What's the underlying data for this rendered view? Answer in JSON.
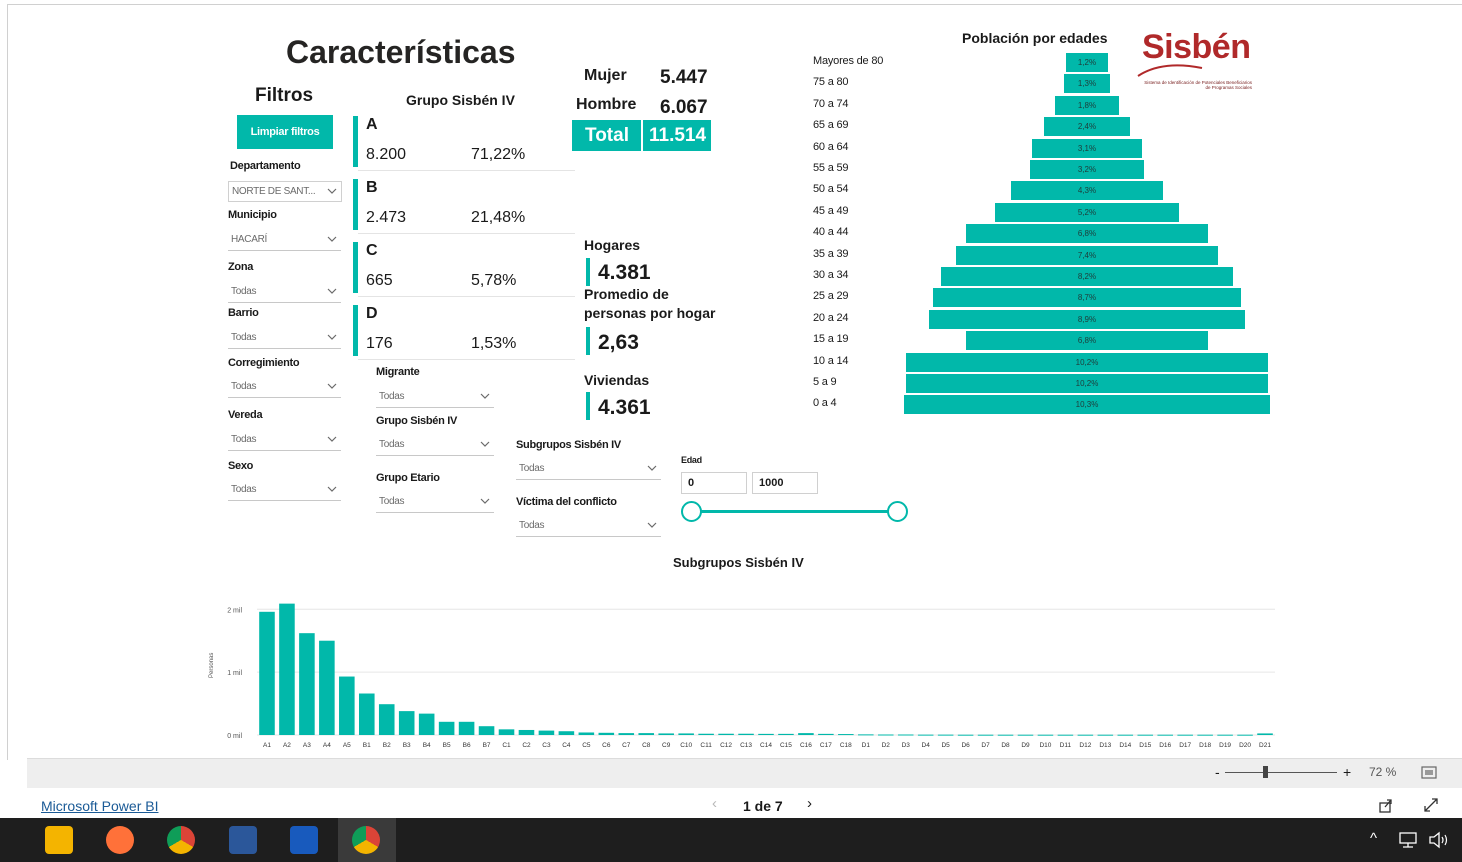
{
  "title": "Características",
  "filters": {
    "heading": "Filtros",
    "clear_button": "Limpiar filtros",
    "departamento": {
      "label": "Departamento",
      "value": "NORTE DE SANT..."
    },
    "municipio": {
      "label": "Municipio",
      "value": "HACARÍ"
    },
    "zona": {
      "label": "Zona",
      "value": "Todas"
    },
    "barrio": {
      "label": "Barrio",
      "value": "Todas"
    },
    "corregimiento": {
      "label": "Corregimiento",
      "value": "Todas"
    },
    "vereda": {
      "label": "Vereda",
      "value": "Todas"
    },
    "sexo": {
      "label": "Sexo",
      "value": "Todas"
    },
    "migrante": {
      "label": "Migrante",
      "value": "Todas"
    },
    "grupo_sisben": {
      "label": "Grupo Sisbén IV",
      "value": "Todas"
    },
    "grupo_etario": {
      "label": "Grupo Etario",
      "value": "Todas"
    },
    "subgrupos": {
      "label": "Subgrupos Sisbén IV",
      "value": "Todas"
    },
    "victima": {
      "label": "Víctima del conflicto",
      "value": "Todas"
    },
    "edad": {
      "label": "Edad",
      "min": "0",
      "max": "1000"
    }
  },
  "groups": {
    "heading": "Grupo Sisbén IV",
    "items": [
      {
        "letter": "A",
        "count": "8.200",
        "pct": "71,22%"
      },
      {
        "letter": "B",
        "count": "2.473",
        "pct": "21,48%"
      },
      {
        "letter": "C",
        "count": "665",
        "pct": "5,78%"
      },
      {
        "letter": "D",
        "count": "176",
        "pct": "1,53%"
      }
    ]
  },
  "sex": {
    "mujer_label": "Mujer",
    "mujer_value": "5.447",
    "hombre_label": "Hombre",
    "hombre_value": "6.067",
    "total_label": "Total",
    "total_value": "11.514"
  },
  "kpis": {
    "hogares_label": "Hogares",
    "hogares_value": "4.381",
    "promedio_label_1": "Promedio de",
    "promedio_label_2": "personas por hogar",
    "promedio_value": "2,63",
    "viviendas_label": "Viviendas",
    "viviendas_value": "4.361"
  },
  "pyramid": {
    "title": "Población por edades",
    "rows": [
      {
        "label": "Mayores de 80",
        "pct": "1,2%",
        "value": 1.2
      },
      {
        "label": "75 a 80",
        "pct": "1,3%",
        "value": 1.3
      },
      {
        "label": "70 a 74",
        "pct": "1,8%",
        "value": 1.8
      },
      {
        "label": "65 a 69",
        "pct": "2,4%",
        "value": 2.4
      },
      {
        "label": "60 a 64",
        "pct": "3,1%",
        "value": 3.1
      },
      {
        "label": "55 a 59",
        "pct": "3,2%",
        "value": 3.2
      },
      {
        "label": "50 a 54",
        "pct": "4,3%",
        "value": 4.3
      },
      {
        "label": "45 a 49",
        "pct": "5,2%",
        "value": 5.2
      },
      {
        "label": "40 a 44",
        "pct": "6,8%",
        "value": 6.8
      },
      {
        "label": "35 a 39",
        "pct": "7,4%",
        "value": 7.4
      },
      {
        "label": "30 a 34",
        "pct": "8,2%",
        "value": 8.2
      },
      {
        "label": "25 a 29",
        "pct": "8,7%",
        "value": 8.7
      },
      {
        "label": "20 a 24",
        "pct": "8,9%",
        "value": 8.9
      },
      {
        "label": "15 a 19",
        "pct": "6,8%",
        "value": 6.8
      },
      {
        "label": "10 a 14",
        "pct": "10,2%",
        "value": 10.2
      },
      {
        "label": "5 a 9",
        "pct": "10,2%",
        "value": 10.2
      },
      {
        "label": "0 a 4",
        "pct": "10,3%",
        "value": 10.3
      }
    ]
  },
  "logo": {
    "word": "Sisbén",
    "tagline": "Sistema de Identificación de Potenciales Beneficiarios de Programas Sociales"
  },
  "chart_data": {
    "type": "bar",
    "title": "Subgrupos Sisbén IV",
    "ylabel": "Personas",
    "yticks": [
      "0 mil",
      "1 mil",
      "2 mil"
    ],
    "ylim": [
      0,
      2100
    ],
    "categories": [
      "A1",
      "A2",
      "A3",
      "A4",
      "A5",
      "B1",
      "B2",
      "B3",
      "B4",
      "B5",
      "B6",
      "B7",
      "C1",
      "C2",
      "C3",
      "C4",
      "C5",
      "C6",
      "C7",
      "C8",
      "C9",
      "C10",
      "C11",
      "C12",
      "C13",
      "C14",
      "C15",
      "C16",
      "C17",
      "C18",
      "D1",
      "D2",
      "D3",
      "D4",
      "D5",
      "D6",
      "D7",
      "D8",
      "D9",
      "D10",
      "D11",
      "D12",
      "D13",
      "D14",
      "D15",
      "D16",
      "D17",
      "D18",
      "D19",
      "D20",
      "D21"
    ],
    "values": [
      1960,
      2090,
      1620,
      1500,
      930,
      660,
      490,
      380,
      340,
      210,
      210,
      140,
      90,
      80,
      70,
      60,
      40,
      35,
      30,
      30,
      25,
      25,
      20,
      20,
      20,
      18,
      18,
      30,
      18,
      15,
      10,
      8,
      8,
      6,
      6,
      5,
      5,
      5,
      5,
      5,
      5,
      5,
      5,
      5,
      5,
      5,
      5,
      5,
      5,
      5,
      25
    ],
    "grid": true
  },
  "pager": {
    "text": "1 de 7",
    "brand": "Microsoft Power BI",
    "zoom": "72 %"
  }
}
